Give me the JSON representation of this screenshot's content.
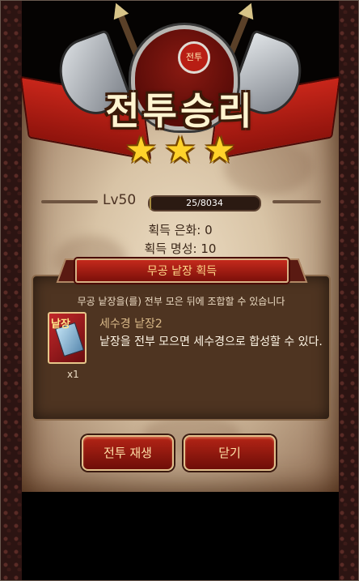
{
  "result": {
    "emblem_badge": "전투",
    "title": "전투승리",
    "stars": [
      "★",
      "★",
      "★"
    ],
    "star_count": 3,
    "level_label": "Lv50",
    "exp_text": "25/8034",
    "exp_fraction": 0.003,
    "rewards": {
      "silver": "획득 은화: 0",
      "fame": "획득 명성: 10"
    }
  },
  "item_panel": {
    "banner_label": "무공 낱장 획득",
    "description": "무공 낱장을(를) 전부 모은 뒤에 조합할 수 있습니다",
    "item": {
      "icon": "scripture-page-icon",
      "icon_mark": "낱장",
      "quantity": "x1",
      "name": "세수경 낱장2",
      "text": "낱장을 전부 모으면 세수경으로 합성할 수 있다."
    }
  },
  "buttons": {
    "replay": "전투 재생",
    "close": "닫기"
  },
  "colors": {
    "accent_red": "#b42416",
    "gold": "#e2c08c",
    "star": "#ffd22a"
  }
}
